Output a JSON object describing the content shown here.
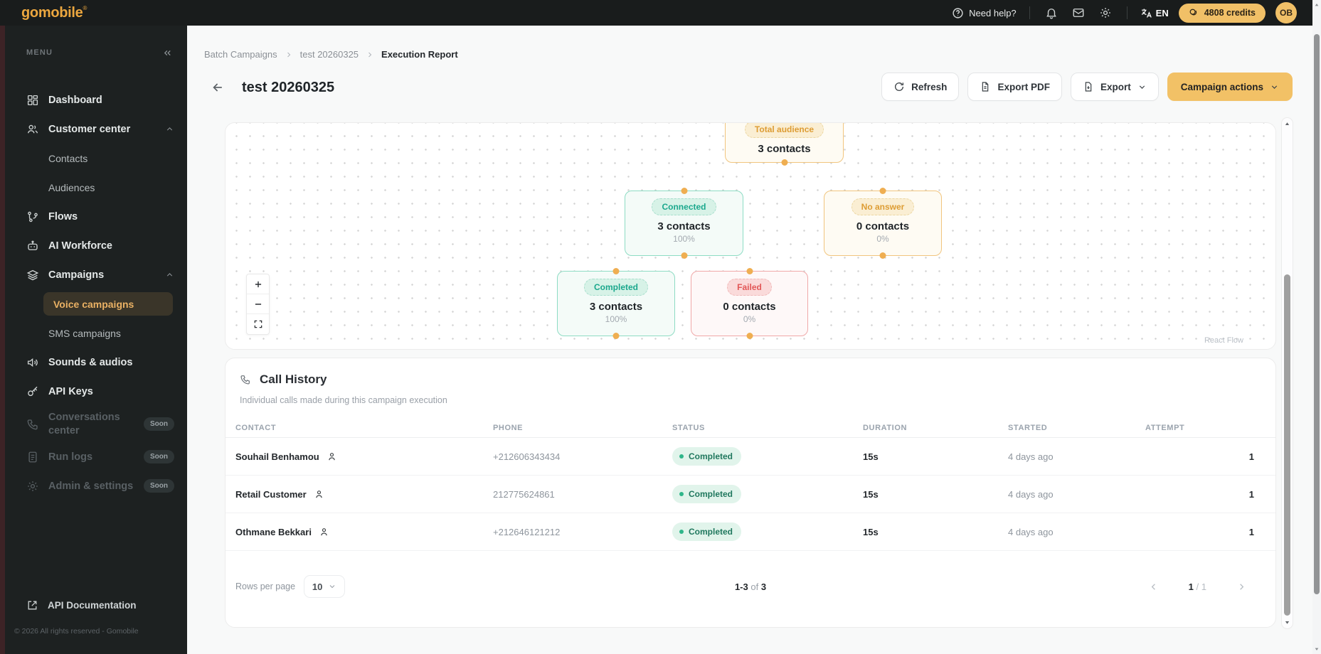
{
  "brand": {
    "logo": "gomobile",
    "trademark": "®",
    "copyright": "© 2026 All rights reserved - Gomobile"
  },
  "topbar": {
    "need_help": "Need help?",
    "lang": "EN",
    "credits": "4808 credits",
    "avatar": "OB"
  },
  "sidebar": {
    "menu_label": "MENU",
    "soon": "Soon",
    "items": [
      {
        "label": "Dashboard"
      },
      {
        "label": "Customer center"
      },
      {
        "label": "Contacts"
      },
      {
        "label": "Audiences"
      },
      {
        "label": "Flows"
      },
      {
        "label": "AI Workforce"
      },
      {
        "label": "Campaigns"
      },
      {
        "label": "Voice campaigns"
      },
      {
        "label": "SMS campaigns"
      },
      {
        "label": "Sounds & audios"
      },
      {
        "label": "API Keys"
      },
      {
        "label": "Conversations center"
      },
      {
        "label": "Run logs"
      },
      {
        "label": "Admin & settings"
      }
    ],
    "footer_link": "API Documentation"
  },
  "breadcrumb": {
    "items": [
      "Batch Campaigns",
      "test 20260325",
      "Execution Report"
    ]
  },
  "page": {
    "title": "test 20260325"
  },
  "actions": {
    "refresh": "Refresh",
    "export_pdf": "Export PDF",
    "export": "Export",
    "campaign_actions": "Campaign actions"
  },
  "flow": {
    "attribution": "React Flow",
    "nodes": [
      {
        "label": "Total audience",
        "contacts": "3 contacts",
        "percent": null
      },
      {
        "label": "Connected",
        "contacts": "3 contacts",
        "percent": "100%"
      },
      {
        "label": "No answer",
        "contacts": "0 contacts",
        "percent": "0%"
      },
      {
        "label": "Completed",
        "contacts": "3 contacts",
        "percent": "100%"
      },
      {
        "label": "Failed",
        "contacts": "0 contacts",
        "percent": "0%"
      }
    ]
  },
  "call_history": {
    "title": "Call History",
    "subtitle": "Individual calls made during this campaign execution",
    "columns": [
      "CONTACT",
      "PHONE",
      "STATUS",
      "DURATION",
      "STARTED",
      "ATTEMPT"
    ],
    "rows": [
      {
        "contact": "Souhail Benhamou",
        "phone": "+212606343434",
        "status": "Completed",
        "duration": "15s",
        "started": "4 days ago",
        "attempt": "1"
      },
      {
        "contact": "Retail Customer",
        "phone": "212775624861",
        "status": "Completed",
        "duration": "15s",
        "started": "4 days ago",
        "attempt": "1"
      },
      {
        "contact": "Othmane Bekkari",
        "phone": "+212646121212",
        "status": "Completed",
        "duration": "15s",
        "started": "4 days ago",
        "attempt": "1"
      }
    ],
    "pagination": {
      "rows_per_page_label": "Rows per page",
      "rows_per_page": "10",
      "range": "1-3",
      "of_label": "of",
      "total": "3",
      "page": "1",
      "pages": "/ 1"
    }
  },
  "colors": {
    "accent_gold": "#F2C166",
    "teal": "#1BA88D",
    "amber": "#DD9C33",
    "red": "#E25757",
    "status_dot": "#2FB68A",
    "sidebar_bg": "#1D2121",
    "topbar_bg": "#191C1C"
  }
}
